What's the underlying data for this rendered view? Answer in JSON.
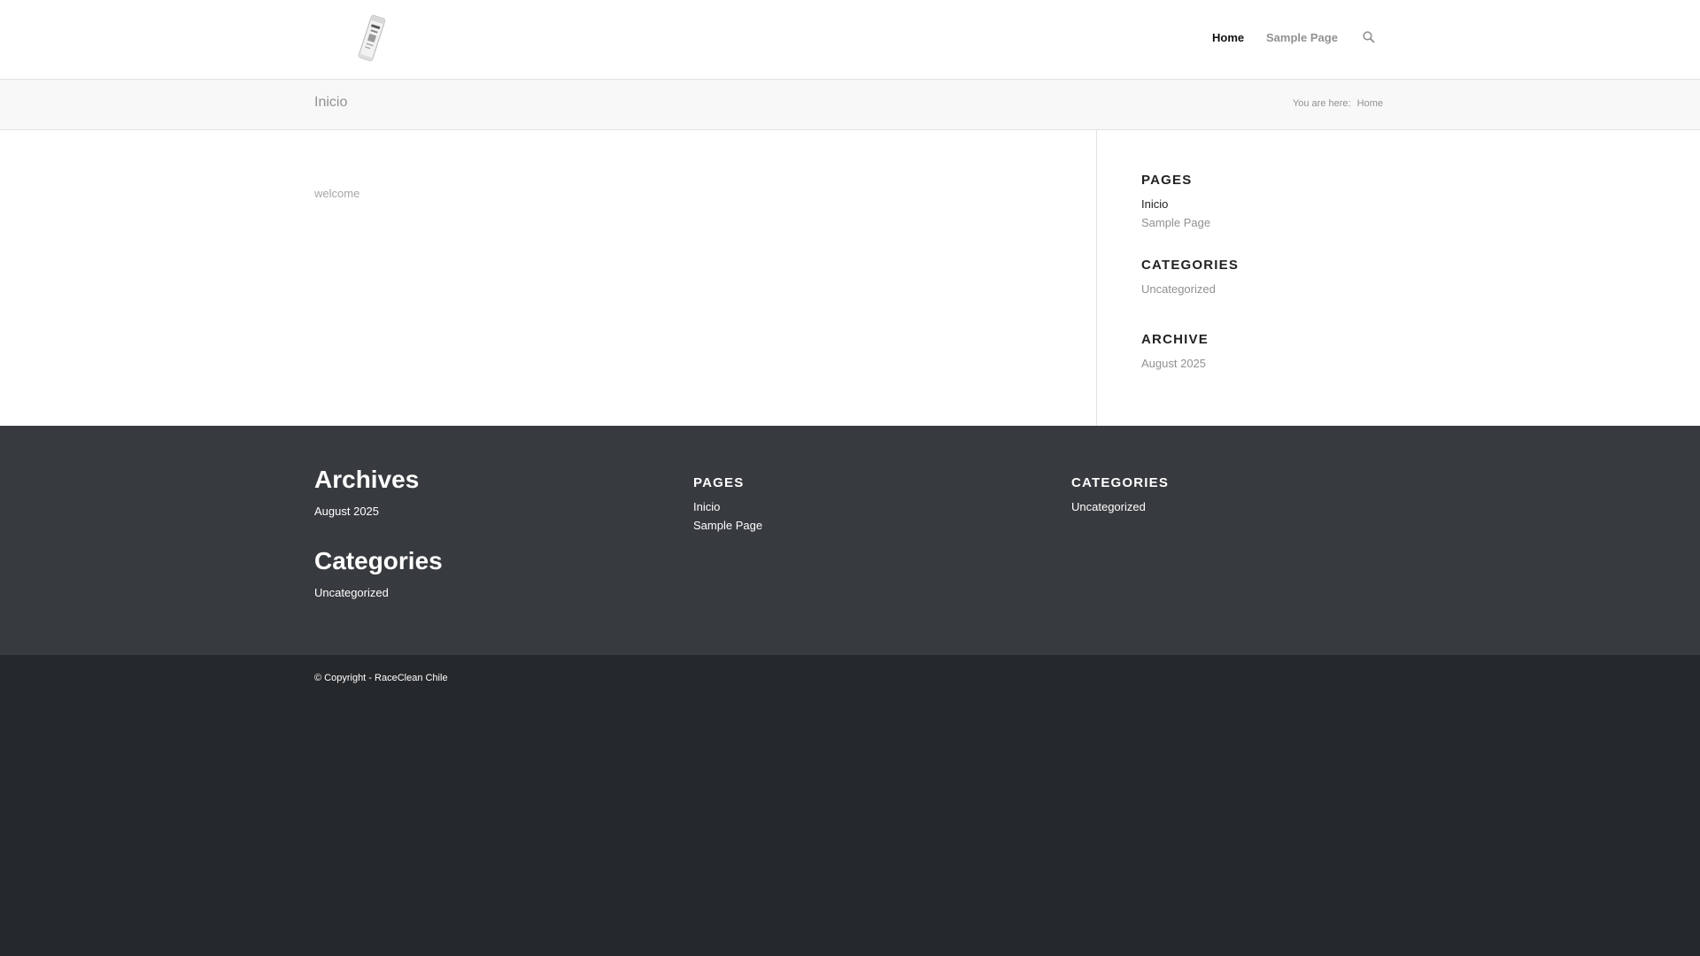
{
  "header": {
    "nav": [
      {
        "label": "Home",
        "active": true
      },
      {
        "label": "Sample Page",
        "active": false
      }
    ],
    "icons": {
      "logo": "product-pouch-logo",
      "search": "search-icon"
    }
  },
  "title_bar": {
    "title": "Inicio",
    "breadcrumb_prefix": "You are here:",
    "breadcrumb_current": "Home"
  },
  "main": {
    "content_text": "welcome"
  },
  "sidebar": {
    "pages": {
      "heading": "PAGES",
      "items": [
        "Inicio",
        "Sample Page"
      ]
    },
    "categories": {
      "heading": "CATEGORIES",
      "items": [
        "Uncategorized"
      ]
    },
    "archive": {
      "heading": "ARCHIVE",
      "items": [
        "August 2025"
      ]
    }
  },
  "footer": {
    "col1": {
      "archives_heading": "Archives",
      "archives_items": [
        "August 2025"
      ],
      "categories_heading": "Categories",
      "categories_items": [
        "Uncategorized"
      ]
    },
    "col2": {
      "heading": "PAGES",
      "items": [
        "Inicio",
        "Sample Page"
      ]
    },
    "col3": {
      "heading": "CATEGORIES",
      "items": [
        "Uncategorized"
      ]
    }
  },
  "socket": {
    "copyright": "© Copyright - RaceClean Chile"
  },
  "colors": {
    "header_bg": "#ffffff",
    "title_bar_bg": "#f8f8f8",
    "footer_bg": "#373a3e",
    "socket_bg": "#26292c",
    "link_muted": "#919191",
    "text_dark": "#222222"
  }
}
